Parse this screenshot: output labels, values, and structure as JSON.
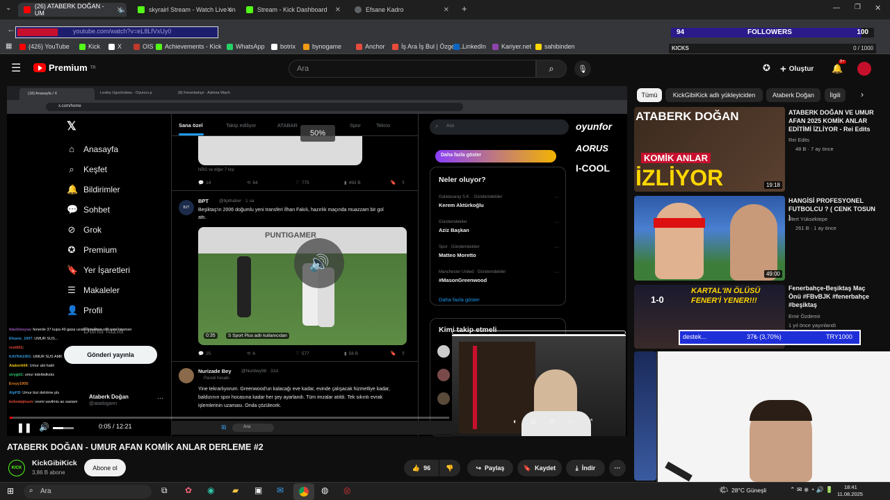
{
  "tabs": [
    {
      "label": "(26) ATABERK DOĞAN - UM",
      "color": "#ff0000",
      "active": true
    },
    {
      "label": "skyrairl Stream - Watch Live on",
      "color": "#53fc18",
      "active": false
    },
    {
      "label": "Stream - Kick Dashboard",
      "color": "#53fc18",
      "active": false
    },
    {
      "label": "Efsane Kadro",
      "color": "#9aa0a6",
      "active": false
    }
  ],
  "address": "youtube.com/watch?v=eL8LfVxUy0",
  "bookmarks": [
    {
      "label": "(426) YouTube",
      "color": "#ff0000"
    },
    {
      "label": "Kick",
      "color": "#53fc18"
    },
    {
      "label": "X",
      "color": "#ffffff"
    },
    {
      "label": "OIS",
      "color": "#c0392b"
    },
    {
      "label": "Achievements - Kick",
      "color": "#53fc18"
    },
    {
      "label": "WhatsApp",
      "color": "#25d366"
    },
    {
      "label": "botrix",
      "color": "#ffffff"
    },
    {
      "label": "bynogame",
      "color": "#f39c12"
    },
    {
      "label": "Anchor",
      "color": "#e74c3c"
    },
    {
      "label": "İş Ara İş Bul | Özgeç...",
      "color": "#e74c3c"
    },
    {
      "label": "LinkedIn",
      "color": "#0a66c2"
    },
    {
      "label": "Kariyer.net",
      "color": "#8e44ad"
    },
    {
      "label": "sahibinden",
      "color": "#ffd700"
    }
  ],
  "overlay": {
    "followers_label": "FOLLOWERS",
    "followers_current": "94",
    "followers_goal": "100",
    "kicks_label": "KICKS",
    "kicks_count": "0 / 1000",
    "donation_label": "destek...",
    "donation_progress": "37₺ (3,70%)",
    "donation_goal": "TRY1000"
  },
  "youtube": {
    "logo": "Premium",
    "logo_sup": "TR",
    "search_placeholder": "Ara",
    "create_label": "Oluştur",
    "notif_count": "9+"
  },
  "inner_browser": {
    "url": "x.com/home",
    "tabs": [
      "(18) Anasayfa / X",
      "Lesley Ugochukwu - Oyuncu p",
      "(8) Fenerbahçe - Admira Wach"
    ],
    "nav": [
      "Anasayfa",
      "Keşfet",
      "Bildirimler",
      "Sohbet",
      "Grok",
      "Premium",
      "Yer İşaretleri",
      "Makaleler",
      "Profil",
      "Daha fazla"
    ],
    "nav_icons": [
      "home-icon",
      "search-icon",
      "bell-icon",
      "chat-icon",
      "grok-icon",
      "premium-icon",
      "bookmark-icon",
      "article-icon",
      "profile-icon",
      "more-icon"
    ],
    "feed_tabs": [
      "Sana özel",
      "Takip ediliyor",
      "ATABAR",
      "Spor",
      "Tekno"
    ],
    "volume_osd": "50%",
    "post1_meta": "NRG ve diğer 7 kişi",
    "post1_stats": [
      "14",
      "64",
      "775",
      "493 B"
    ],
    "post2_author": "BPT",
    "post2_handle": "@bpthaber · 1 sa",
    "post2_text": "Beşiktaş'ın 2006 doğumlu yeni transferi İlhan Fakılı, hazırlık maçında muazzam bir gol attı.",
    "post2_video_time": "0:35",
    "post2_video_source": "S Sport Plus adlı kullanıcıdan",
    "post2_stats": [
      "25",
      "6",
      "577",
      "58 B"
    ],
    "post3_author": "Nurizade Bey",
    "post3_handle": "@Nuribey98 · 31d",
    "post3_badge": "Parodi hesabı",
    "post3_text": "Yine tekrarlıyorum. Greenwood'un kalacağı eve kadar, evinde çalışacak hizmetliye kadar, baldızının spor hocasına kadar her şey ayarlandı. Tüm imzalar atıldı. Tek sıkıntı evrak işlemlerinin uzaması. Onda çözülecek.",
    "search_placeholder": "Ara",
    "promo_button": "Daha fazla göster",
    "trends_title": "Neler oluyor?",
    "trends": [
      {
        "meta": "Galatasaray S.K. · Gündemdekiler",
        "title": "Kerem Aktürkoğlu"
      },
      {
        "meta": "Gündemdekiler",
        "title": "Aziz Başkan"
      },
      {
        "meta": "Spor · Gündemdekiler",
        "title": "Matteo Moretto"
      },
      {
        "meta": "Manchester United · Gündemdekiler",
        "title": "#MasonGreenwood"
      }
    ],
    "trends_more": "Daha fazla göster",
    "who_to_follow": "Kimi takip etmeli",
    "post_button": "Gönderi yayınla",
    "profile_name": "Ataberk Doğan",
    "profile_handle": "@atadogann",
    "taskbar_search": "Ara"
  },
  "chat": [
    {
      "user": "blacklosysa",
      "text": "fenerde 37 kupa 49 gene uzaklaşmaktan söz sayı ozaman",
      "color": "#9b59b6"
    },
    {
      "user": "Efsane_1907",
      "text": "UMUR SUS...",
      "color": "#3498db"
    },
    {
      "user": "resttt51",
      "text": "",
      "color": "#e74c3c"
    },
    {
      "user": "KAYRA1901",
      "text": "UMUR SUS AMK",
      "color": "#3498db"
    },
    {
      "user": "Ataberk64",
      "text": "Umur abi hakli",
      "color": "#f1c40f"
    },
    {
      "user": "sirygit1",
      "text": "umur kdekkdkskz",
      "color": "#2ecc71"
    },
    {
      "user": "Ersyy1905",
      "text": "",
      "color": "#e67e22"
    },
    {
      "user": "AlpFB",
      "text": "Umur bizi delirtme pls",
      "color": "#3498db"
    },
    {
      "user": "kobratajisum",
      "text": "resmi savilmis ao sasiam",
      "color": "#e74c3c"
    }
  ],
  "player": {
    "time": "0:05 / 12:21",
    "progress": 0.007,
    "volume": 0.5
  },
  "video_title": "ATABERK DOĞAN - UMUR AFAN KOMİK ANLAR DERLEME #2",
  "channel": {
    "name": "KickGibiKick",
    "subs": "3,86 B abone",
    "subscribe": "Abone ol"
  },
  "actions": {
    "likes": "96",
    "share": "Paylaş",
    "save": "Kaydet",
    "download": "İndir"
  },
  "chips": [
    "Tümü",
    "KickGibiKick adlı yükleyiciden",
    "Ataberk Doğan",
    "İlgili"
  ],
  "recommendations": [
    {
      "title": "ATABERK DOĞAN VE UMUR AFAN 2025 KOMİK ANLAR EDİTİMİ İZLİYOR - Rei Edits",
      "channel": "Rei Edits",
      "meta": "48 B · 7 ay önce",
      "duration": "19:18",
      "thumb_text": "KOMİK ANLAR",
      "thumb_big": "İZLİYOR",
      "thumb_top": "ATABERK DOĞAN"
    },
    {
      "title": "HANGİSİ PROFESYONEL FUTBOLCU ? ( CENK TOSUN )",
      "channel": "Mert Yüksektepe",
      "meta": "261 B · 1 ay önce",
      "duration": "49:00"
    },
    {
      "title": "Fenerbahçe-Beşiktaş Maç Önü #FBvBJK #fenerbahçe #beşiktaş",
      "channel": "Emir Özdemir",
      "meta": "1 yıl önce yayınlandı",
      "thumb_text": "KARTAL'IN ÖLÜSÜ FENER'İ YENER!!!",
      "thumb_score": "1-0"
    }
  ],
  "sponsors": [
    "oyunfor",
    "AORUS",
    "I-COOL"
  ],
  "windows_taskbar": {
    "search": "Ara",
    "weather": "28°C  Güneşli",
    "time": "18:41",
    "date": "11.08.2025"
  }
}
